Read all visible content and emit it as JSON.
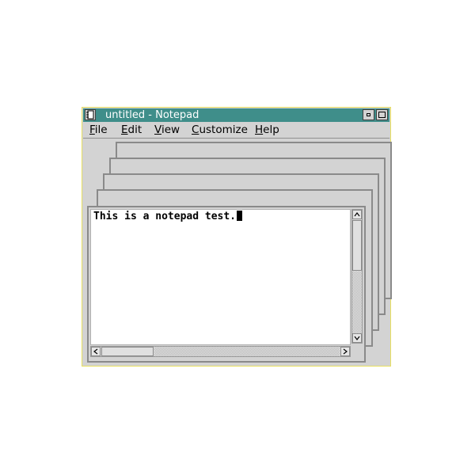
{
  "window": {
    "title": "untitled - Notepad",
    "colors": {
      "titlebar": "#3f8e8a",
      "frame": "#e8e060",
      "chrome": "#d3d3d3"
    }
  },
  "titlebar_buttons": [
    "minimize-icon",
    "maximize-icon"
  ],
  "menu": {
    "file": {
      "mnemonic": "F",
      "rest": "ile"
    },
    "edit": {
      "mnemonic": "E",
      "rest": "dit"
    },
    "view": {
      "mnemonic": "V",
      "rest": "iew"
    },
    "customize": {
      "mnemonic": "C",
      "rest": "ustomize"
    },
    "help": {
      "mnemonic": "H",
      "rest": "elp"
    }
  },
  "editor": {
    "text": "This is a notepad test."
  }
}
